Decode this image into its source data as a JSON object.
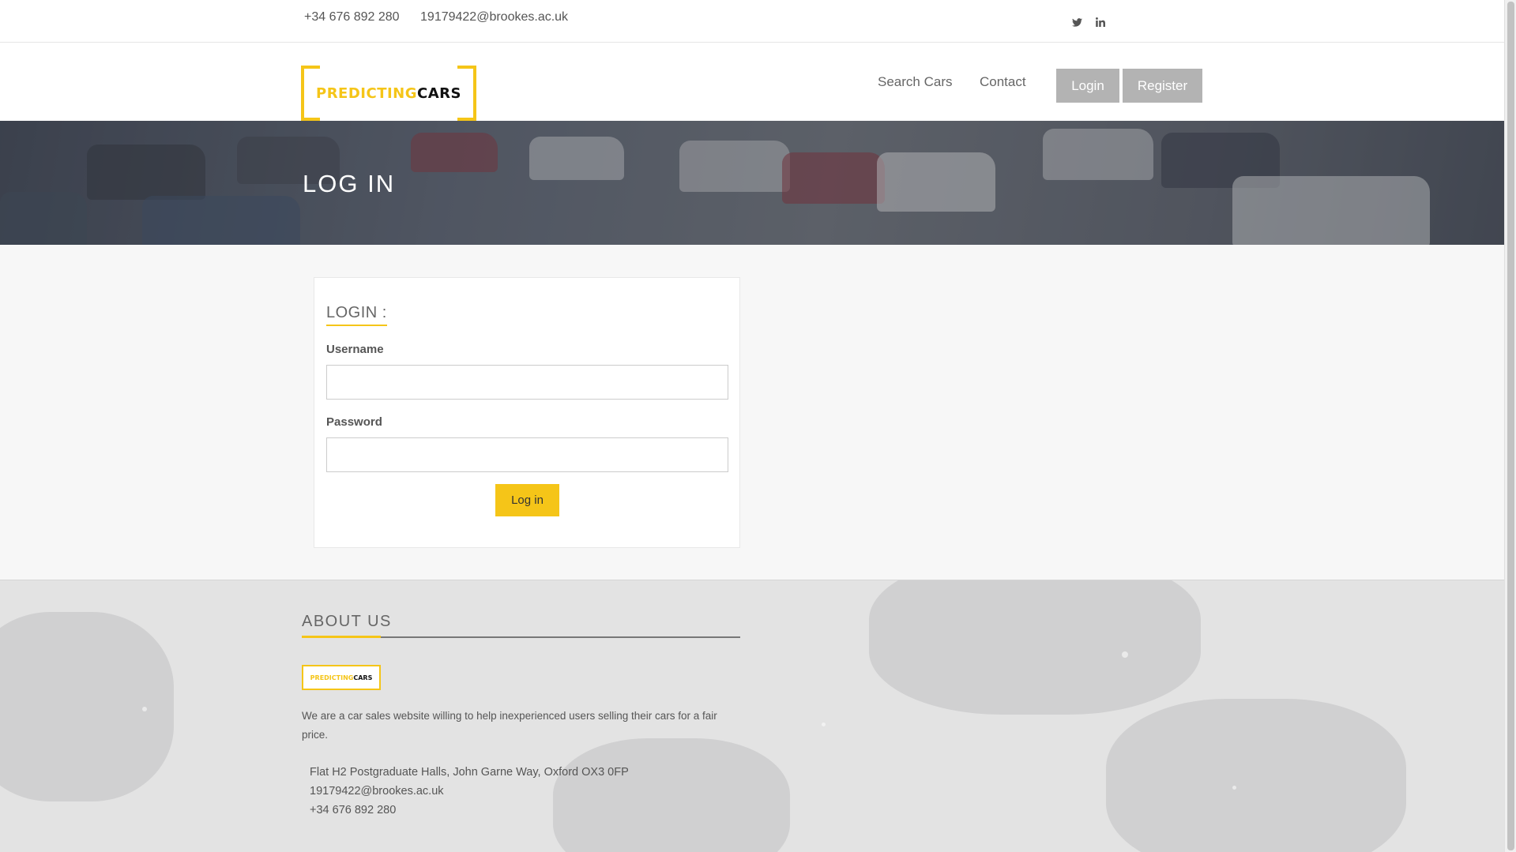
{
  "topbar": {
    "phone": "+34 676 892 280",
    "email": "19179422@brookes.ac.uk",
    "social": [
      {
        "icon": "twitter-icon",
        "glyph": "🐦"
      },
      {
        "icon": "linkedin-icon",
        "glyph": "in"
      }
    ]
  },
  "header": {
    "logo_part1": "PREDICTING",
    "logo_part2": "CARS",
    "nav": {
      "search_cars": "Search Cars",
      "contact": "Contact"
    },
    "buttons": {
      "login": "Login",
      "register": "Register"
    }
  },
  "banner": {
    "title": "LOG IN"
  },
  "login_form": {
    "title": "LOGIN :",
    "username_label": "Username",
    "username_value": "",
    "password_label": "Password",
    "password_value": "",
    "submit_label": "Log in"
  },
  "footer": {
    "about_title": "ABOUT US",
    "logo_part1": "PREDICTING",
    "logo_part2": "CARS",
    "about_text": "We are a car sales website willing to help inexperienced users selling their cars for a fair price.",
    "address": "Flat H2 Postgraduate Halls, John Garne Way, Oxford OX3 0FP",
    "email": "19179422@brookes.ac.uk",
    "phone": "+34 676 892 280"
  },
  "colors": {
    "accent": "#f5c518",
    "button_gray": "#b3b3b3"
  }
}
